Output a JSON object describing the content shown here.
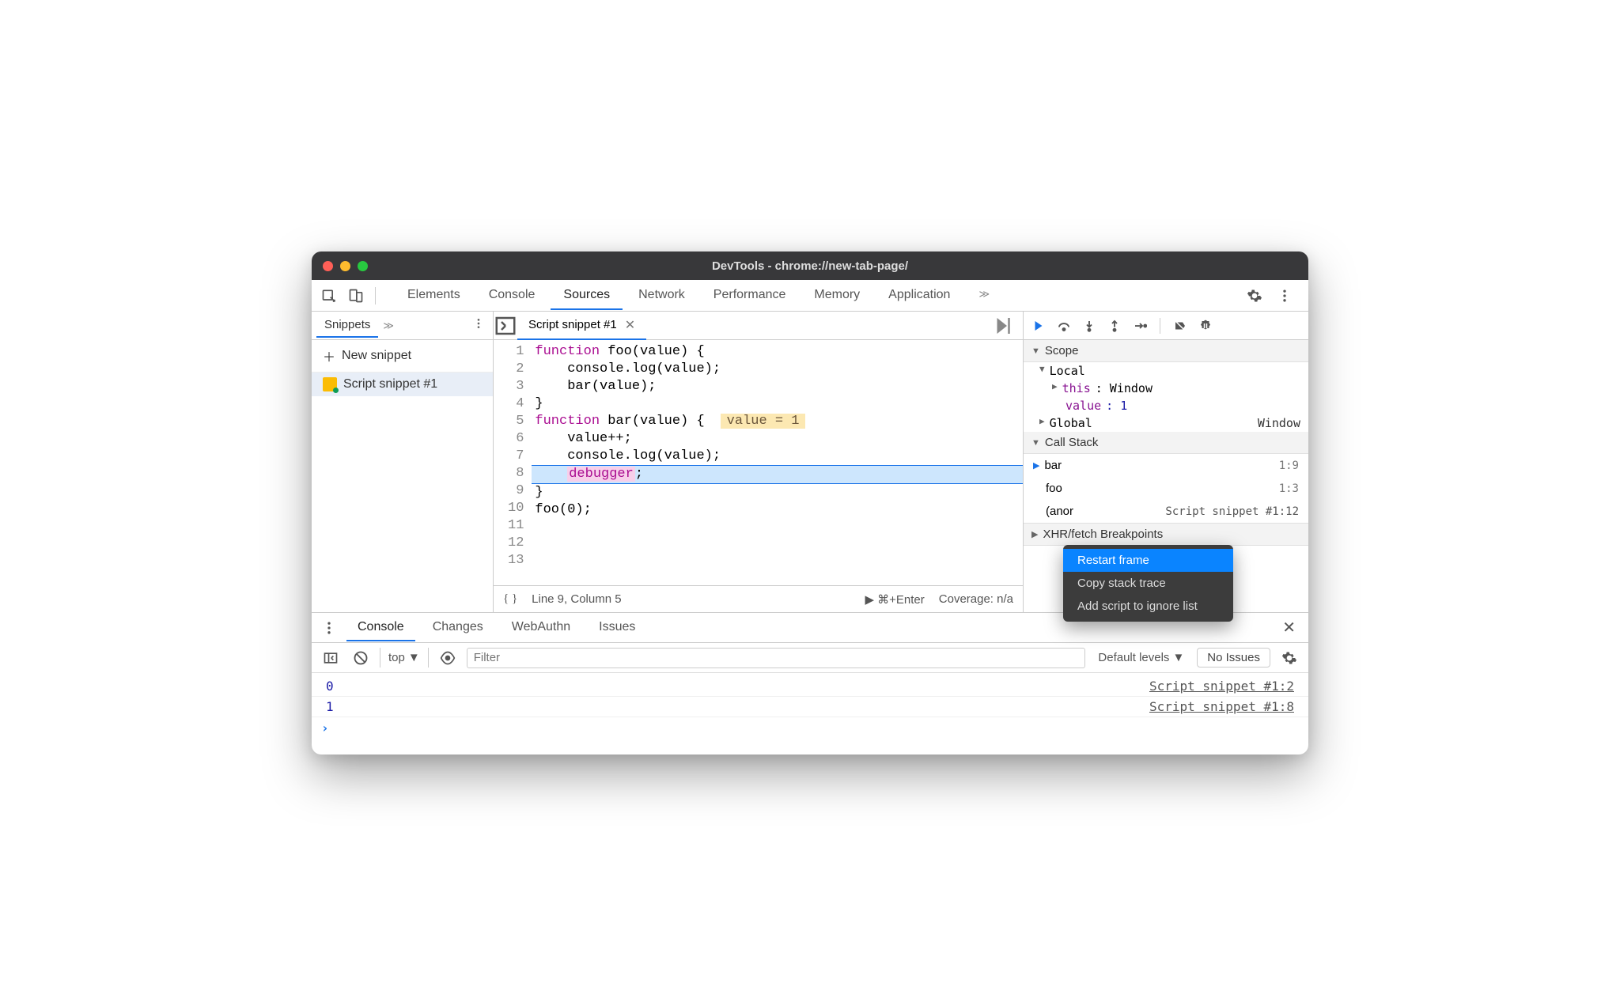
{
  "window": {
    "title": "DevTools - chrome://new-tab-page/"
  },
  "top_tabs": {
    "elements": "Elements",
    "console": "Console",
    "sources": "Sources",
    "network": "Network",
    "performance": "Performance",
    "memory": "Memory",
    "application": "Application"
  },
  "sidebar": {
    "snippets_tab": "Snippets",
    "new_snippet": "New snippet",
    "item1": "Script snippet #1"
  },
  "editor": {
    "tab_title": "Script snippet #1",
    "hint": "value = 1",
    "lines": {
      "l1a": "function",
      "l1b": " foo(value) {",
      "l2": "    console.log(value);",
      "l3": "    bar(value);",
      "l4": "}",
      "l5": "",
      "l6a": "function",
      "l6b": " bar(value) {",
      "l7": "    value++;",
      "l8": "    console.log(value);",
      "l9a": "    ",
      "l9b": "debugger",
      "l9c": ";",
      "l10": "}",
      "l11": "",
      "l12": "foo(0);",
      "l13": ""
    },
    "status": {
      "cursor": "Line 9, Column 5",
      "run": "⌘+Enter",
      "coverage": "Coverage: n/a"
    }
  },
  "debugger": {
    "scope_header": "Scope",
    "local": "Local",
    "this_key": "this",
    "this_val": ": Window",
    "value_key": "value",
    "value_val": ": 1",
    "global_key": "Global",
    "global_val": "Window",
    "callstack_header": "Call Stack",
    "bar": "bar",
    "bar_loc": "1:9",
    "foo": "foo",
    "foo_loc": "1:3",
    "anon": "(anor",
    "anon_loc": "Script snippet #1:12",
    "xhr": "XHR/fetch Breakpoints"
  },
  "context_menu": {
    "restart": "Restart frame",
    "copy": "Copy stack trace",
    "ignore": "Add script to ignore list"
  },
  "drawer": {
    "console": "Console",
    "changes": "Changes",
    "webauthn": "WebAuthn",
    "issues": "Issues"
  },
  "console_toolbar": {
    "context": "top",
    "filter_placeholder": "Filter",
    "levels": "Default levels",
    "no_issues": "No Issues"
  },
  "console": {
    "row1_val": "0",
    "row1_src": "Script snippet #1:2",
    "row2_val": "1",
    "row2_src": "Script snippet #1:8"
  }
}
